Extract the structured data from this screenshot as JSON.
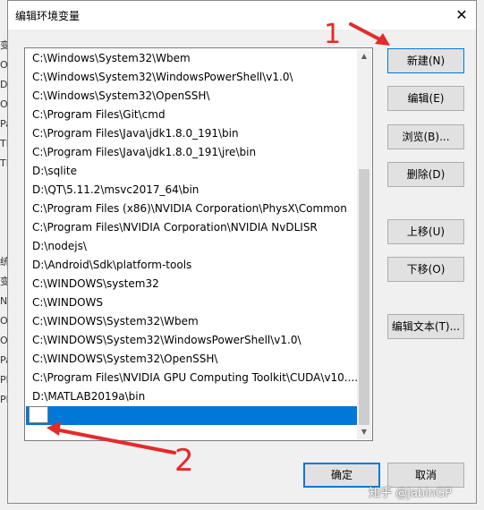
{
  "dialog": {
    "title": "编辑环境变量",
    "close_glyph": "✕"
  },
  "paths": [
    "C:\\Windows\\System32\\Wbem",
    "C:\\Windows\\System32\\WindowsPowerShell\\v1.0\\",
    "C:\\Windows\\System32\\OpenSSH\\",
    "C:\\Program Files\\Git\\cmd",
    "C:\\Program Files\\Java\\jdk1.8.0_191\\bin",
    "C:\\Program Files\\Java\\jdk1.8.0_191\\jre\\bin",
    "D:\\sqlite",
    "D:\\QT\\5.11.2\\msvc2017_64\\bin",
    "C:\\Program Files (x86)\\NVIDIA Corporation\\PhysX\\Common",
    "C:\\Program Files\\NVIDIA Corporation\\NVIDIA NvDLISR",
    "D:\\nodejs\\",
    "D:\\Android\\Sdk\\platform-tools",
    "C:\\WINDOWS\\system32",
    "C:\\WINDOWS",
    "C:\\WINDOWS\\System32\\Wbem",
    "C:\\WINDOWS\\System32\\WindowsPowerShell\\v1.0\\",
    "C:\\WINDOWS\\System32\\OpenSSH\\",
    "C:\\Program Files\\NVIDIA GPU Computing Toolkit\\CUDA\\v10....",
    "D:\\MATLAB2019a\\bin"
  ],
  "new_entry_value": "",
  "buttons": {
    "new": "新建(N)",
    "edit": "编辑(E)",
    "browse": "浏览(B)...",
    "delete": "删除(D)",
    "move_up": "上移(U)",
    "move_down": "下移(O)",
    "edit_text": "编辑文本(T)...",
    "ok": "确定",
    "cancel": "取消"
  },
  "scrollbar": {
    "up_glyph": "▲",
    "down_glyph": "▼"
  },
  "background_letters": [
    "变",
    "O",
    "D",
    "O",
    "Pa",
    "TE",
    "TN",
    "",
    "",
    "",
    "",
    "统",
    "变",
    "N",
    "O",
    "O",
    "Pa",
    "PE",
    "PF"
  ],
  "watermark": "知乎 @JabinGP",
  "annotations": {
    "mark_1": "1",
    "mark_2": "2"
  },
  "colors": {
    "selection": "#0078d7",
    "annotation": "#e52a2a"
  }
}
